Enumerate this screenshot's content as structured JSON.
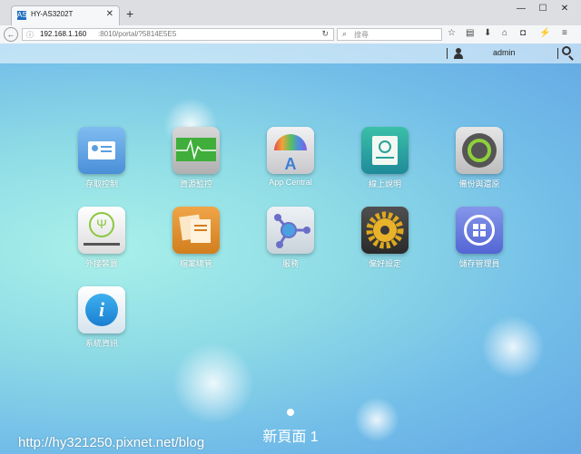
{
  "browser": {
    "tab_title": "HY-AS3202T",
    "tab_favicon": "AS",
    "url_host": "192.168.1.160",
    "url_path": ":8010/portal/?5814E5E5",
    "search_placeholder": "搜尋",
    "window_controls": [
      "minimize-icon",
      "maximize-icon",
      "close-icon"
    ]
  },
  "topbar": {
    "user_label": "admin"
  },
  "apps": [
    {
      "label": "存取控制",
      "icon": "id-card-icon",
      "color": "#5a9ee0"
    },
    {
      "label": "資源監控",
      "icon": "heartbeat-monitor-icon",
      "color": "#3fae3a"
    },
    {
      "label": "App Central",
      "icon": "app-central-icon",
      "color": "#e8e8ea"
    },
    {
      "label": "線上說明",
      "icon": "help-book-icon",
      "color": "#2aa09a"
    },
    {
      "label": "備份與還原",
      "icon": "backup-restore-icon",
      "color": "#7a7a7a"
    },
    {
      "label": "外接裝置",
      "icon": "usb-icon",
      "color": "#f4f4f4"
    },
    {
      "label": "檔案總管",
      "icon": "file-explorer-icon",
      "color": "#e0962e"
    },
    {
      "label": "服務",
      "icon": "services-icon",
      "color": "#dfe6ec"
    },
    {
      "label": "偏好設定",
      "icon": "gear-icon",
      "color": "#3a3a3a"
    },
    {
      "label": "儲存管理員",
      "icon": "storage-manager-icon",
      "color": "#6d7fe0"
    },
    {
      "label": "系統資訊",
      "icon": "info-icon",
      "color": "#e8f2fa"
    }
  ],
  "page_indicator": "新頁面 1",
  "watermark": "http://hy321250.pixnet.net/blog"
}
